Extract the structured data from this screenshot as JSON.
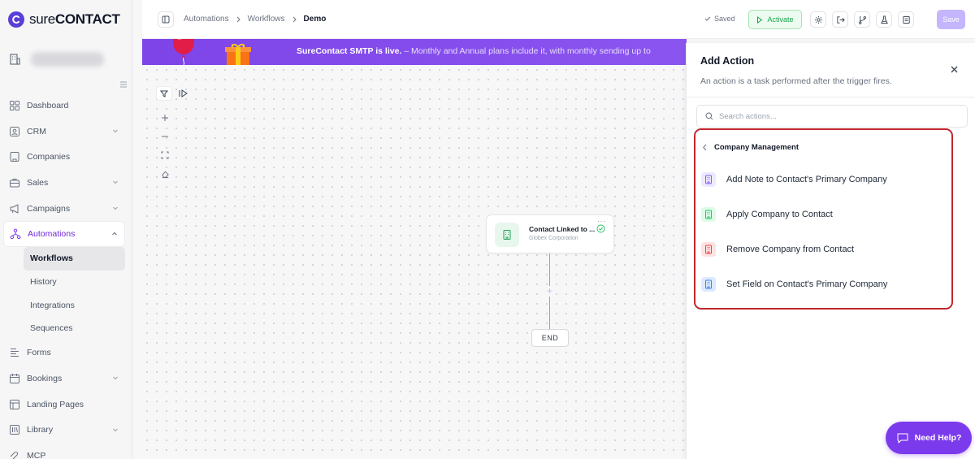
{
  "app": {
    "logo_text_light": "sure",
    "logo_text_bold": "CONTACT"
  },
  "sidebar": {
    "items": [
      {
        "label": "Dashboard"
      },
      {
        "label": "CRM"
      },
      {
        "label": "Companies"
      },
      {
        "label": "Sales"
      },
      {
        "label": "Campaigns"
      },
      {
        "label": "Automations"
      },
      {
        "label": "Forms"
      },
      {
        "label": "Bookings"
      },
      {
        "label": "Landing Pages"
      },
      {
        "label": "Library"
      },
      {
        "label": "MCP"
      }
    ],
    "sub_items": [
      {
        "label": "Workflows"
      },
      {
        "label": "History"
      },
      {
        "label": "Integrations"
      },
      {
        "label": "Sequences"
      }
    ]
  },
  "breadcrumb": {
    "root": "Automations",
    "mid": "Workflows",
    "current": "Demo"
  },
  "toolbar": {
    "saved_label": "Saved",
    "activate_label": "Activate",
    "save_label": "Save"
  },
  "banner": {
    "bold": "SureContact SMTP is live.",
    "text": " – Monthly and Annual plans include it, with monthly sending up to"
  },
  "canvas": {
    "node": {
      "title": "Contact Linked to ...",
      "subtitle": "Globex Corporation"
    },
    "end_label": "END"
  },
  "panel": {
    "title": "Add Action",
    "description": "An action is a task performed after the trigger fires.",
    "search_placeholder": "Search actions...",
    "group_label": "Company Management",
    "actions": [
      {
        "label": "Add Note to Contact's Primary Company",
        "color": "#8b5cf6"
      },
      {
        "label": "Apply Company to Contact",
        "color": "#22c55e"
      },
      {
        "label": "Remove Company from Contact",
        "color": "#ef4444"
      },
      {
        "label": "Set Field on Contact's Primary Company",
        "color": "#3b82f6"
      }
    ]
  },
  "help": {
    "label": "Need Help?"
  },
  "colors": {
    "brand": "#7c3aed",
    "highlight": "#c1272d"
  }
}
